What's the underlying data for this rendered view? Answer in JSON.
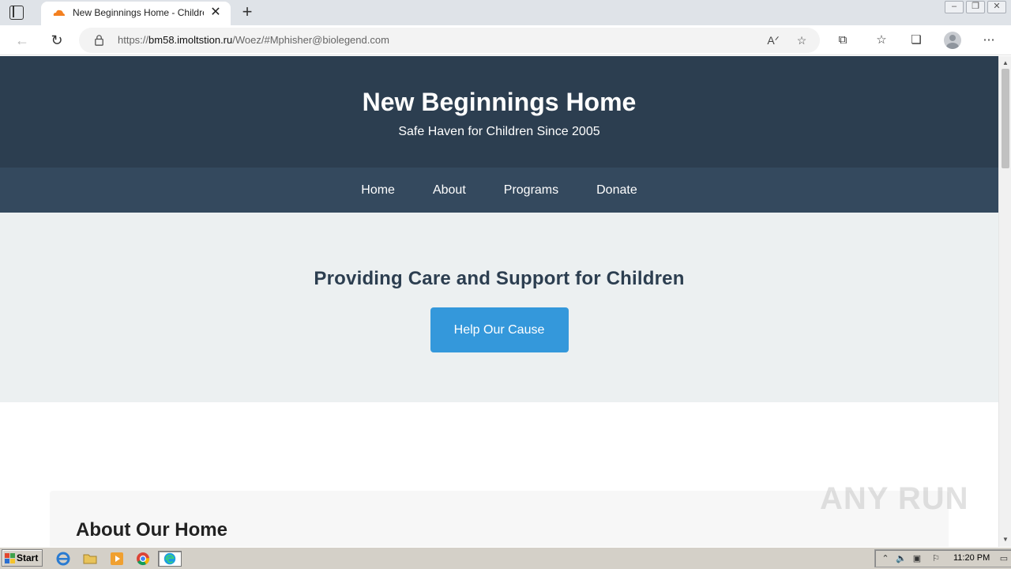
{
  "browser": {
    "tab_title": "New Beginnings Home - Children's Home",
    "url_prefix": "https://",
    "url_host": "bm58.imoltstion.ru",
    "url_path": "/Woez/#Mphisher@biolegend.com",
    "new_tab_symbol": "+",
    "close_symbol": "✕"
  },
  "site": {
    "title": "New Beginnings Home",
    "tagline": "Safe Haven for Children Since 2005",
    "nav": [
      "Home",
      "About",
      "Programs",
      "Donate"
    ],
    "hero_title": "Providing Care and Support for Children",
    "cta_label": "Help Our Cause",
    "about_title": "About Our Home",
    "colors": {
      "header_bg": "#2c3e50",
      "nav_bg": "#34495e",
      "hero_bg": "#ecf0f1",
      "cta_bg": "#3498db"
    }
  },
  "watermark": "ANY RUN",
  "taskbar": {
    "start_label": "Start",
    "clock": "11:20 PM",
    "quick_launch_icons": [
      "ie-icon",
      "folder-icon",
      "media-player-icon",
      "chrome-icon",
      "edge-icon"
    ]
  }
}
